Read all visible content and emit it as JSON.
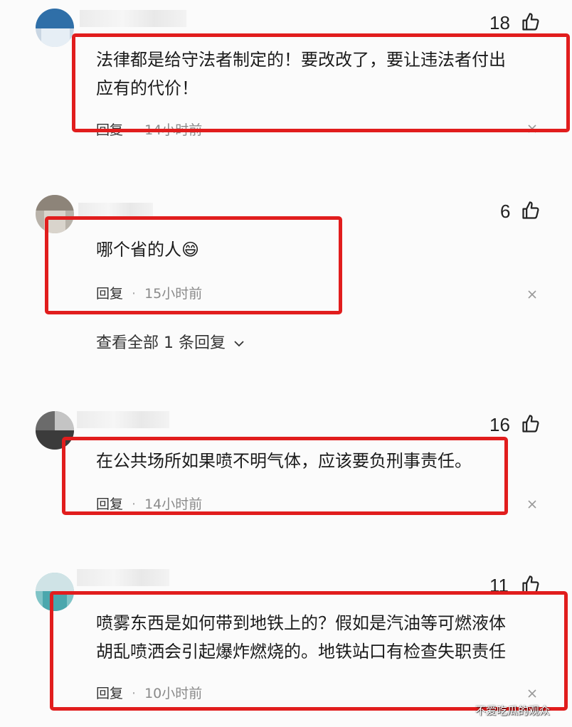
{
  "comments": [
    {
      "likes": "18",
      "lines": [
        "法律都是给守法者制定的！要改改了，要让违法者付出",
        "应有的代价！"
      ],
      "reply_label": "回复",
      "time": "14小时前"
    },
    {
      "likes": "6",
      "lines": [
        "哪个省的人"
      ],
      "emoji": "😄",
      "reply_label": "回复",
      "time": "15小时前"
    },
    {
      "likes": "16",
      "lines": [
        "在公共场所如果喷不明气体，应该要负刑事责任。"
      ],
      "reply_label": "回复",
      "time": "14小时前"
    },
    {
      "likes": "11",
      "lines": [
        "喷雾东西是如何带到地铁上的？假如是汽油等可燃液体",
        "胡乱喷洒会引起爆炸燃烧的。地铁站口有检查失职责任"
      ],
      "reply_label": "回复",
      "time": "10小时前"
    }
  ],
  "view_replies": "查看全部 1 条回复",
  "watermark": "不爱吃瓜的观众",
  "colors": {
    "highlight_box": "#e11d1d",
    "background": "#fbfbfb"
  },
  "icons": [
    "thumbs-up-icon",
    "close-icon",
    "chevron-down-icon"
  ]
}
